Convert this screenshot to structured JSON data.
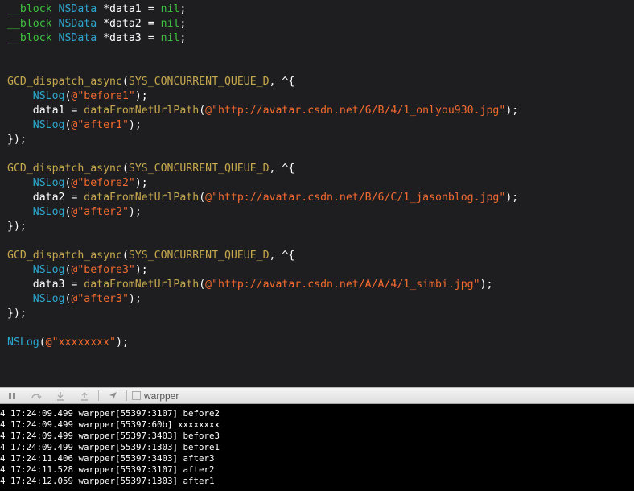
{
  "editor": {
    "colors": {
      "keyword": "#3fc03f",
      "type": "#2da6cf",
      "function": "#c7a84e",
      "string": "#f26a2f",
      "text": "#ffffff",
      "background": "#1e1e20"
    },
    "lines": [
      [
        {
          "t": "__block",
          "c": "kw"
        },
        {
          "t": " ",
          "c": "plain"
        },
        {
          "t": "NSData",
          "c": "type"
        },
        {
          "t": " *data1 = ",
          "c": "plain"
        },
        {
          "t": "nil",
          "c": "lit"
        },
        {
          "t": ";",
          "c": "plain"
        }
      ],
      [
        {
          "t": "__block",
          "c": "kw"
        },
        {
          "t": " ",
          "c": "plain"
        },
        {
          "t": "NSData",
          "c": "type"
        },
        {
          "t": " *data2 = ",
          "c": "plain"
        },
        {
          "t": "nil",
          "c": "lit"
        },
        {
          "t": ";",
          "c": "plain"
        }
      ],
      [
        {
          "t": "__block",
          "c": "kw"
        },
        {
          "t": " ",
          "c": "plain"
        },
        {
          "t": "NSData",
          "c": "type"
        },
        {
          "t": " *data3 = ",
          "c": "plain"
        },
        {
          "t": "nil",
          "c": "lit"
        },
        {
          "t": ";",
          "c": "plain"
        }
      ],
      [],
      [],
      [
        {
          "t": "GCD_dispatch_async",
          "c": "fn"
        },
        {
          "t": "(",
          "c": "plain"
        },
        {
          "t": "SYS_CONCURRENT_QUEUE_D",
          "c": "fn"
        },
        {
          "t": ", ^{",
          "c": "plain"
        }
      ],
      [
        {
          "t": "    ",
          "c": "plain"
        },
        {
          "t": "NSLog",
          "c": "type"
        },
        {
          "t": "(",
          "c": "plain"
        },
        {
          "t": "@\"before1\"",
          "c": "str"
        },
        {
          "t": ");",
          "c": "plain"
        }
      ],
      [
        {
          "t": "    data1 = ",
          "c": "plain"
        },
        {
          "t": "dataFromNetUrlPath",
          "c": "fn"
        },
        {
          "t": "(",
          "c": "plain"
        },
        {
          "t": "@\"http://avatar.csdn.net/6/B/4/1_onlyou930.jpg\"",
          "c": "str"
        },
        {
          "t": ");",
          "c": "plain"
        }
      ],
      [
        {
          "t": "    ",
          "c": "plain"
        },
        {
          "t": "NSLog",
          "c": "type"
        },
        {
          "t": "(",
          "c": "plain"
        },
        {
          "t": "@\"after1\"",
          "c": "str"
        },
        {
          "t": ");",
          "c": "plain"
        }
      ],
      [
        {
          "t": "});",
          "c": "plain"
        }
      ],
      [],
      [
        {
          "t": "GCD_dispatch_async",
          "c": "fn"
        },
        {
          "t": "(",
          "c": "plain"
        },
        {
          "t": "SYS_CONCURRENT_QUEUE_D",
          "c": "fn"
        },
        {
          "t": ", ^{",
          "c": "plain"
        }
      ],
      [
        {
          "t": "    ",
          "c": "plain"
        },
        {
          "t": "NSLog",
          "c": "type"
        },
        {
          "t": "(",
          "c": "plain"
        },
        {
          "t": "@\"before2\"",
          "c": "str"
        },
        {
          "t": ");",
          "c": "plain"
        }
      ],
      [
        {
          "t": "    data2 = ",
          "c": "plain"
        },
        {
          "t": "dataFromNetUrlPath",
          "c": "fn"
        },
        {
          "t": "(",
          "c": "plain"
        },
        {
          "t": "@\"http://avatar.csdn.net/B/6/C/1_jasonblog.jpg\"",
          "c": "str"
        },
        {
          "t": ");",
          "c": "plain"
        }
      ],
      [
        {
          "t": "    ",
          "c": "plain"
        },
        {
          "t": "NSLog",
          "c": "type"
        },
        {
          "t": "(",
          "c": "plain"
        },
        {
          "t": "@\"after2\"",
          "c": "str"
        },
        {
          "t": ");",
          "c": "plain"
        }
      ],
      [
        {
          "t": "});",
          "c": "plain"
        }
      ],
      [],
      [
        {
          "t": "GCD_dispatch_async",
          "c": "fn"
        },
        {
          "t": "(",
          "c": "plain"
        },
        {
          "t": "SYS_CONCURRENT_QUEUE_D",
          "c": "fn"
        },
        {
          "t": ", ^{",
          "c": "plain"
        }
      ],
      [
        {
          "t": "    ",
          "c": "plain"
        },
        {
          "t": "NSLog",
          "c": "type"
        },
        {
          "t": "(",
          "c": "plain"
        },
        {
          "t": "@\"before3\"",
          "c": "str"
        },
        {
          "t": ");",
          "c": "plain"
        }
      ],
      [
        {
          "t": "    data3 = ",
          "c": "plain"
        },
        {
          "t": "dataFromNetUrlPath",
          "c": "fn"
        },
        {
          "t": "(",
          "c": "plain"
        },
        {
          "t": "@\"http://avatar.csdn.net/A/A/4/1_simbi.jpg\"",
          "c": "str"
        },
        {
          "t": ");",
          "c": "plain"
        }
      ],
      [
        {
          "t": "    ",
          "c": "plain"
        },
        {
          "t": "NSLog",
          "c": "type"
        },
        {
          "t": "(",
          "c": "plain"
        },
        {
          "t": "@\"after3\"",
          "c": "str"
        },
        {
          "t": ");",
          "c": "plain"
        }
      ],
      [
        {
          "t": "});",
          "c": "plain"
        }
      ],
      [],
      [
        {
          "t": "NSLog",
          "c": "type"
        },
        {
          "t": "(",
          "c": "plain"
        },
        {
          "t": "@\"xxxxxxxx\"",
          "c": "str"
        },
        {
          "t": ");",
          "c": "plain"
        }
      ]
    ]
  },
  "debug_bar": {
    "icons": [
      "pause-icon",
      "step-over-icon",
      "step-into-icon",
      "step-out-icon",
      "location-icon"
    ],
    "target_label": "warpper"
  },
  "console": {
    "lines": [
      "4 17:24:09.499 warpper[55397:3107] before2",
      "4 17:24:09.499 warpper[55397:60b] xxxxxxxx",
      "4 17:24:09.499 warpper[55397:3403] before3",
      "4 17:24:09.499 warpper[55397:1303] before1",
      "4 17:24:11.406 warpper[55397:3403] after3",
      "4 17:24:11.528 warpper[55397:3107] after2",
      "4 17:24:12.059 warpper[55397:1303] after1"
    ]
  }
}
